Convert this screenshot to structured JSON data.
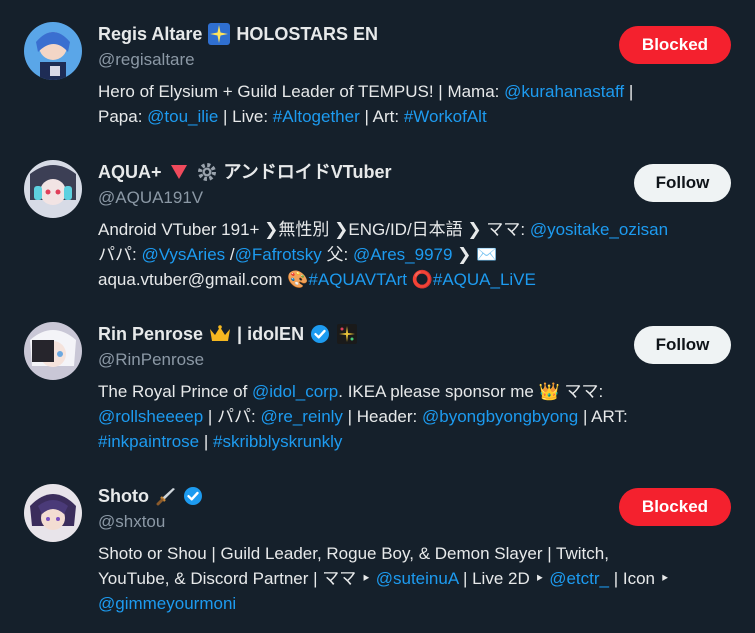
{
  "accounts": [
    {
      "name": "Regis Altare",
      "name_suffix": "HOLOSTARS EN",
      "handle": "@regisaltare",
      "button": "Blocked",
      "bio": [
        {
          "t": "Hero of Elysium + Guild Leader of TEMPUS! | Mama: "
        },
        {
          "t": "@kurahanastaff",
          "link": true
        },
        {
          "t": " | "
        },
        {
          "br": true
        },
        {
          "t": "Papa: "
        },
        {
          "t": "@tou_ilie",
          "link": true
        },
        {
          "t": " | Live: "
        },
        {
          "t": "#Altogether",
          "link": true
        },
        {
          "t": " | Art: "
        },
        {
          "t": "#WorkofAlt",
          "link": true
        }
      ]
    },
    {
      "name": "AQUA+",
      "name_suffix": "アンドロイドVTuber",
      "handle": "@AQUA191V",
      "button": "Follow",
      "bio": [
        {
          "t": "Android VTuber 191+ ❯無性別 ❯ENG/ID/日本語 ❯ ママ: "
        },
        {
          "t": "@yositake_ozisan",
          "link": true
        },
        {
          "br": true
        },
        {
          "t": "パパ: "
        },
        {
          "t": "@VysAries",
          "link": true
        },
        {
          "t": " /"
        },
        {
          "t": "@Fafrotsky",
          "link": true
        },
        {
          "t": " 父: "
        },
        {
          "t": "@Ares_9979",
          "link": true
        },
        {
          "t": " ❯ ✉️"
        },
        {
          "br": true
        },
        {
          "t": "aqua.vtuber@gmail.com 🎨"
        },
        {
          "t": "#AQUAVTArt",
          "link": true
        },
        {
          "t": " ⭕"
        },
        {
          "t": "#AQUA_LiVE",
          "link": true
        }
      ]
    },
    {
      "name": "Rin Penrose",
      "name_suffix": "| idolEN",
      "handle": "@RinPenrose",
      "button": "Follow",
      "bio": [
        {
          "t": "The Royal Prince of "
        },
        {
          "t": "@idol_corp",
          "link": true
        },
        {
          "t": ". IKEA please sponsor me 👑 ママ:"
        },
        {
          "br": true
        },
        {
          "t": "@rollsheeeep",
          "link": true
        },
        {
          "t": " | パパ: "
        },
        {
          "t": "@re_reinly",
          "link": true
        },
        {
          "t": " | Header: "
        },
        {
          "t": "@byongbyongbyong",
          "link": true
        },
        {
          "t": " | ART:"
        },
        {
          "br": true
        },
        {
          "t": "#inkpaintrose",
          "link": true
        },
        {
          "t": " | "
        },
        {
          "t": "#skribblyskrunkly",
          "link": true
        }
      ]
    },
    {
      "name": "Shoto",
      "name_suffix": "",
      "handle": "@shxtou",
      "button": "Blocked",
      "bio": [
        {
          "t": "Shoto or Shou | Guild Leader, Rogue Boy, & Demon Slayer | Twitch,"
        },
        {
          "br": true
        },
        {
          "t": "YouTube, & Discord Partner | ママ ‣ "
        },
        {
          "t": "@suteinuA",
          "link": true
        },
        {
          "t": " | Live 2D ‣ "
        },
        {
          "t": "@etctr_",
          "link": true
        },
        {
          "t": " | Icon ‣"
        },
        {
          "br": true
        },
        {
          "t": "@gimmeyourmoni",
          "link": true
        }
      ]
    }
  ],
  "colors": {
    "background": "#15202b",
    "link": "#1d9bf0",
    "blocked_button": "#f4212e",
    "follow_button": "#eff3f4",
    "handle": "#8b98a5"
  },
  "icons": {
    "regis_badge": "sparkle-badge-icon",
    "aqua_heart": "red-triangle-icon",
    "aqua_gear": "gear-icon",
    "rin_crown": "crown-icon",
    "rin_verified": "verified-badge-icon",
    "rin_sparkle": "sparkle-icon",
    "shoto_sword": "dagger-icon",
    "shoto_verified": "verified-badge-icon"
  }
}
